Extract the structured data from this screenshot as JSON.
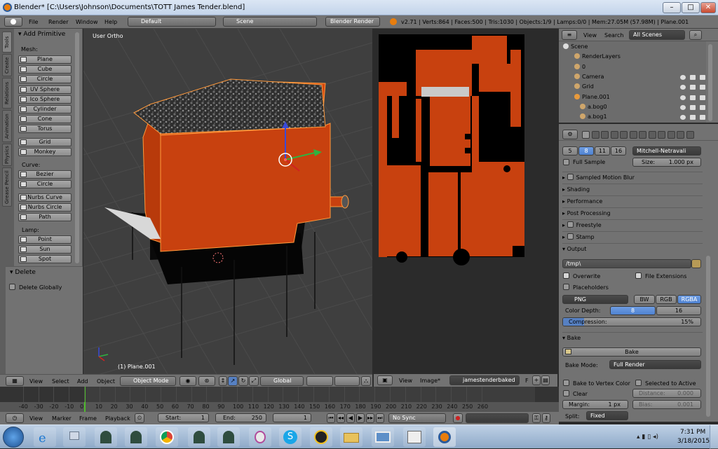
{
  "window": {
    "title": "Blender* [C:\\Users\\Johnson\\Documents\\TOTT James Tender.blend]",
    "min": "–",
    "max": "□",
    "close": "✕"
  },
  "info": {
    "menus": [
      "File",
      "Render",
      "Window",
      "Help"
    ],
    "screen": "Default",
    "scene": "Scene",
    "engine": "Blender Render",
    "stats": "v2.71 | Verts:864 | Faces:500 | Tris:1030 | Objects:1/9 | Lamps:0/0 | Mem:27.05M (57.98M) | Plane.001"
  },
  "shelf": {
    "tabs": [
      "Tools",
      "Create",
      "Relations",
      "Animation",
      "Physics",
      "Grease Pencil"
    ],
    "add_primitive": "Add Primitive",
    "mesh_label": "Mesh:",
    "mesh": [
      "Plane",
      "Cube",
      "Circle",
      "UV Sphere",
      "Ico Sphere",
      "Cylinder",
      "Cone",
      "Torus"
    ],
    "misc": [
      "Grid",
      "Monkey"
    ],
    "curve_label": "Curve:",
    "curve": [
      "Bezier",
      "Circle"
    ],
    "nurbs": [
      "Nurbs Curve",
      "Nurbs Circle",
      "Path"
    ],
    "lamp_label": "Lamp:",
    "lamp": [
      "Point",
      "Sun",
      "Spot"
    ],
    "delete_head": "Delete",
    "delete_globally": "Delete Globally"
  },
  "viewport": {
    "view_name": "User Ortho",
    "object_name": "(1) Plane.001"
  },
  "vp_header": {
    "menus": [
      "View",
      "Select",
      "Add",
      "Object"
    ],
    "mode": "Object Mode",
    "orientation": "Global"
  },
  "uv_header": {
    "menus": [
      "View",
      "Image*"
    ],
    "image": "jamestenderbaked",
    "f": "F"
  },
  "outliner": {
    "menus": [
      "View",
      "Search"
    ],
    "filter": "All Scenes",
    "rows": [
      "Scene",
      "RenderLayers",
      "0",
      "Camera",
      "Grid",
      "Plane.001",
      "a.bog0",
      "a.bog1"
    ]
  },
  "props": {
    "aa_samples": [
      "5",
      "8",
      "11",
      "16"
    ],
    "aa_filter": "Mitchell-Netravali",
    "full_sample": "Full Sample",
    "size_label": "Size:",
    "size_value": "1.000 px",
    "panels": [
      "Sampled Motion Blur",
      "Shading",
      "Performance",
      "Post Processing",
      "Freestyle",
      "Stamp"
    ],
    "output_head": "Output",
    "output_path": "/tmp\\",
    "overwrite": "Overwrite",
    "file_extensions": "File Extensions",
    "placeholders": "Placeholders",
    "format": "PNG",
    "color_modes": [
      "BW",
      "RGB",
      "RGBA"
    ],
    "color_depth_label": "Color Depth:",
    "depths": [
      "8",
      "16"
    ],
    "compression_label": "Compression:",
    "compression_value": "15%",
    "compression_fraction": 0.15,
    "bake_head": "Bake",
    "bake_button": "Bake",
    "bake_mode_label": "Bake Mode:",
    "bake_mode": "Full Render",
    "bake_to_vertex": "Bake to Vertex Color",
    "selected_to_active": "Selected to Active",
    "clear": "Clear",
    "distance_label": "Distance:",
    "distance_value": "0.000",
    "margin_label": "Margin:",
    "margin_value": "1 px",
    "bias_label": "Bias:",
    "bias_value": "0.001",
    "split_label": "Split:",
    "split_value": "Fixed"
  },
  "timeline": {
    "ticks": [
      "-40",
      "-30",
      "-20",
      "-10",
      "0",
      "10",
      "20",
      "30",
      "40",
      "50",
      "60",
      "70",
      "80",
      "90",
      "100",
      "110",
      "120",
      "130",
      "140",
      "150",
      "160",
      "170",
      "180",
      "190",
      "200",
      "210",
      "220",
      "230",
      "240",
      "250",
      "260"
    ],
    "current_frame": 0,
    "menus": [
      "View",
      "Marker",
      "Frame",
      "Playback"
    ],
    "start_label": "Start:",
    "start_value": "1",
    "end_label": "End:",
    "end_value": "250",
    "current_value": "1",
    "sync": "No Sync"
  },
  "taskbar": {
    "time": "7:31 PM",
    "date": "3/18/2015"
  },
  "colors": {
    "accent": "#5680c2",
    "model": "#c8410f",
    "panel": "#727272"
  }
}
